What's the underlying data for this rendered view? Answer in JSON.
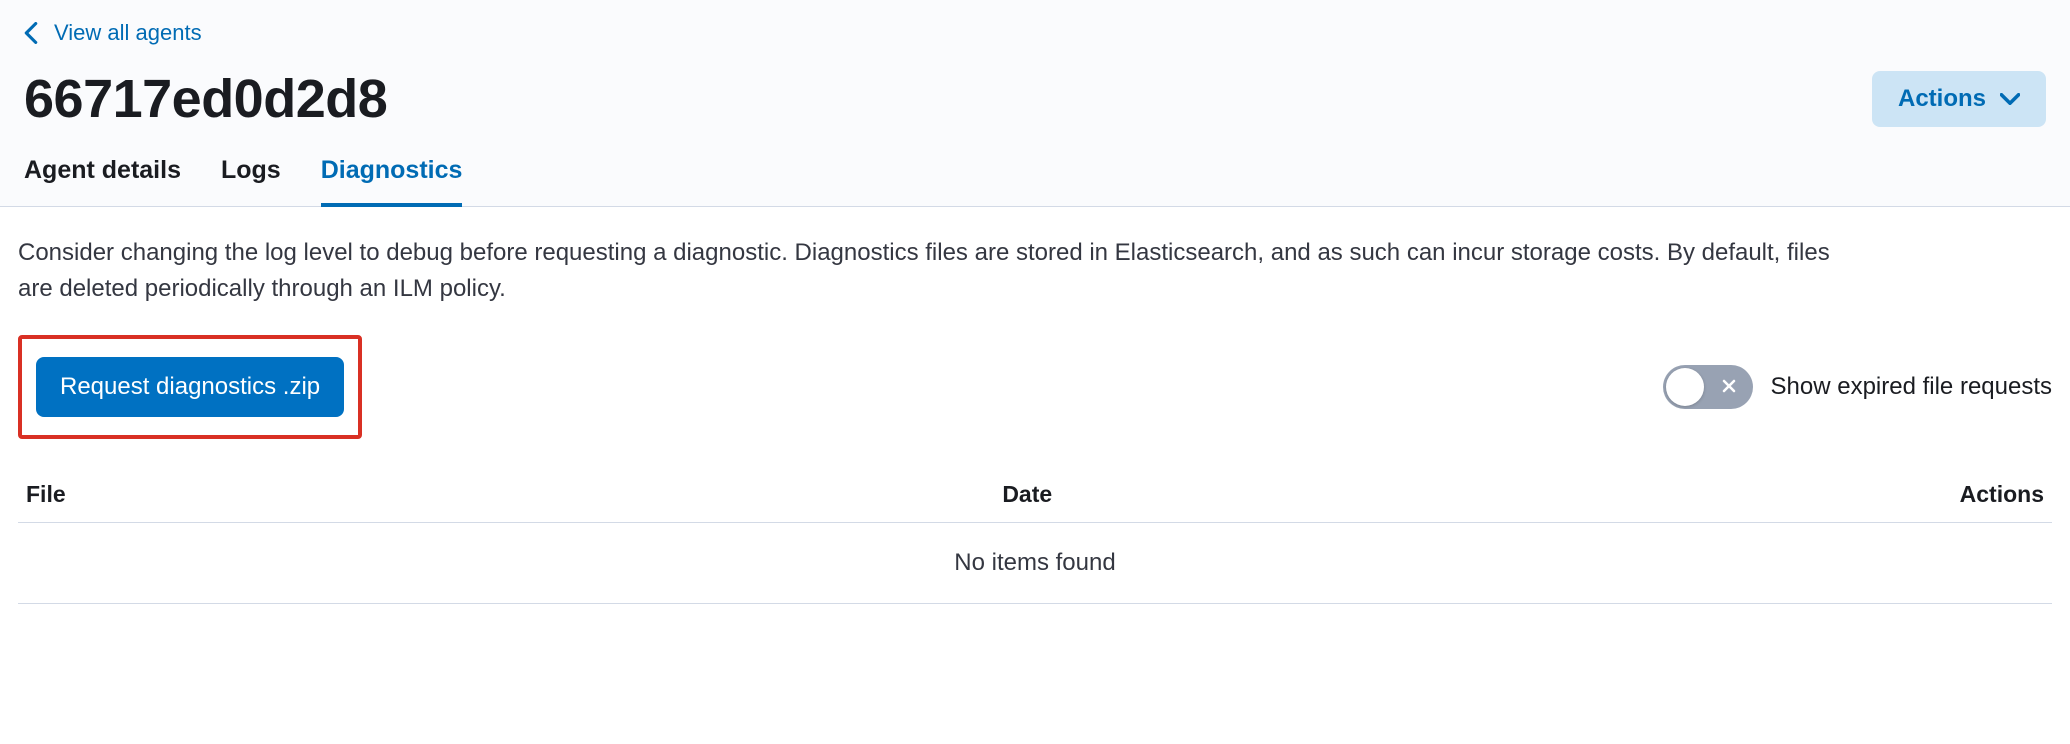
{
  "back_link": {
    "label": "View all agents"
  },
  "page_title": "66717ed0d2d8",
  "actions_button": {
    "label": "Actions"
  },
  "tabs": [
    {
      "label": "Agent details",
      "active": false
    },
    {
      "label": "Logs",
      "active": false
    },
    {
      "label": "Diagnostics",
      "active": true
    }
  ],
  "description": "Consider changing the log level to debug before requesting a diagnostic. Diagnostics files are stored in Elasticsearch, and as such can incur storage costs. By default, files are deleted periodically through an ILM policy.",
  "request_button": {
    "label": "Request diagnostics .zip"
  },
  "toggle": {
    "label": "Show expired file requests",
    "on": false
  },
  "table": {
    "columns": [
      {
        "label": "File"
      },
      {
        "label": "Date"
      },
      {
        "label": "Actions"
      }
    ],
    "empty_message": "No items found"
  }
}
